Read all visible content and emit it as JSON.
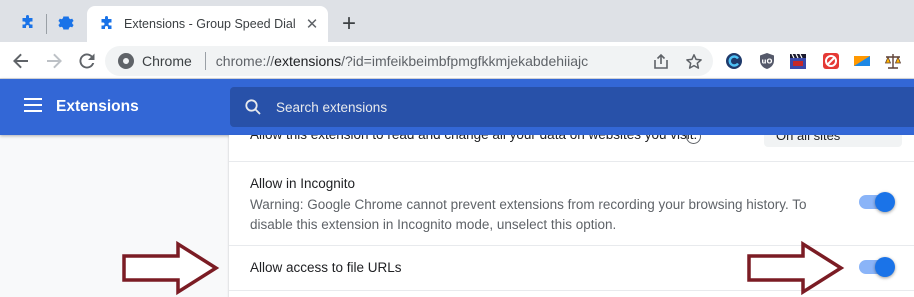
{
  "tabstrip": {
    "active_tab_title": "Extensions - Group Speed Dial",
    "close_glyph": "✕",
    "new_tab_glyph": "+",
    "pinned_tabs": [
      {
        "icon": "puzzle-icon"
      },
      {
        "icon": "gear-icon"
      }
    ]
  },
  "toolbar": {
    "site_label": "Chrome",
    "url_scheme": "chrome://",
    "url_host": "extensions",
    "url_path": "/?id=imfeikbeimbfpmgfkkmjekabdehiiajc",
    "extension_icons": [
      "sync-icon",
      "ublock-icon",
      "clapper-icon",
      "blocker-icon",
      "flag-icon",
      "scales-icon"
    ]
  },
  "header": {
    "title": "Extensions",
    "search_placeholder": "Search extensions"
  },
  "settings": {
    "incognito_title": "Allow in Incognito",
    "incognito_desc": "Warning: Google Chrome cannot prevent extensions from recording your browsing history. To disable this extension in Incognito mode, unselect this option.",
    "incognito_enabled": true,
    "file_urls_title": "Allow access to file URLs",
    "file_urls_enabled": true
  },
  "colors": {
    "header_bg": "#3367d6",
    "search_bg": "#2851a9",
    "toggle_on": "#1a73e8",
    "arrow_stroke": "#7b1c24"
  }
}
